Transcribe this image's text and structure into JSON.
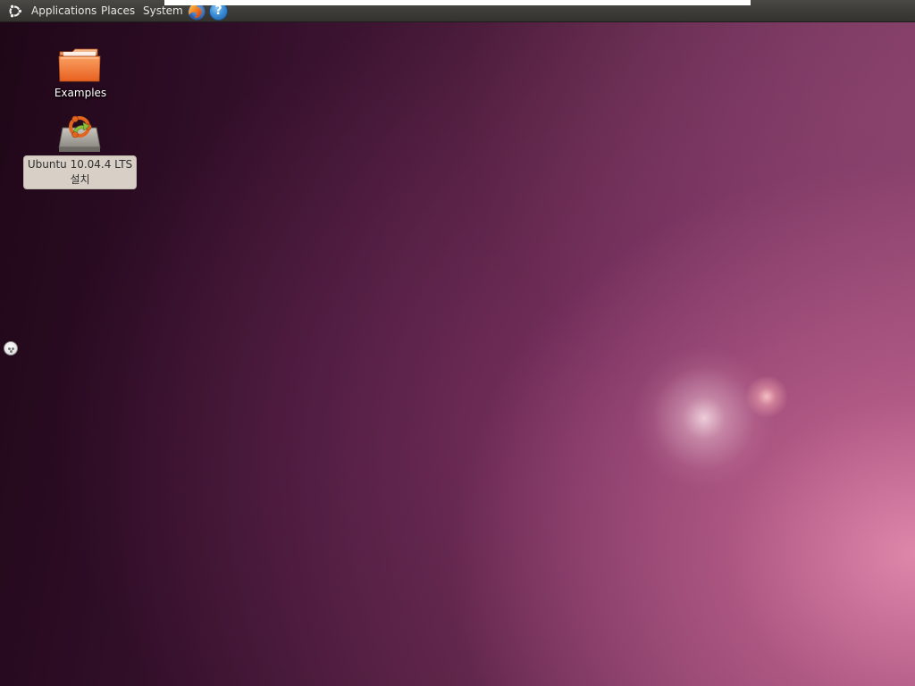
{
  "top_panel": {
    "menus": [
      {
        "label": "Applications"
      },
      {
        "label": "Places"
      },
      {
        "label": "System"
      }
    ],
    "launchers": [
      {
        "icon": "firefox-icon"
      },
      {
        "icon": "help-icon",
        "glyph": "?"
      }
    ],
    "logo_icon": "ubuntu-logo-icon"
  },
  "desktop": {
    "icons": [
      {
        "label": "Examples",
        "icon": "folder-icon"
      },
      {
        "label_lines": [
          "Ubuntu 10.04.4 LTS",
          "설치"
        ],
        "icon": "installer-drive-icon"
      }
    ]
  },
  "colors": {
    "panel": "#3d3c38",
    "wallpaper_dark": "#2c0c24",
    "wallpaper_light": "#d98aa8",
    "folder": "#f07d3c"
  }
}
